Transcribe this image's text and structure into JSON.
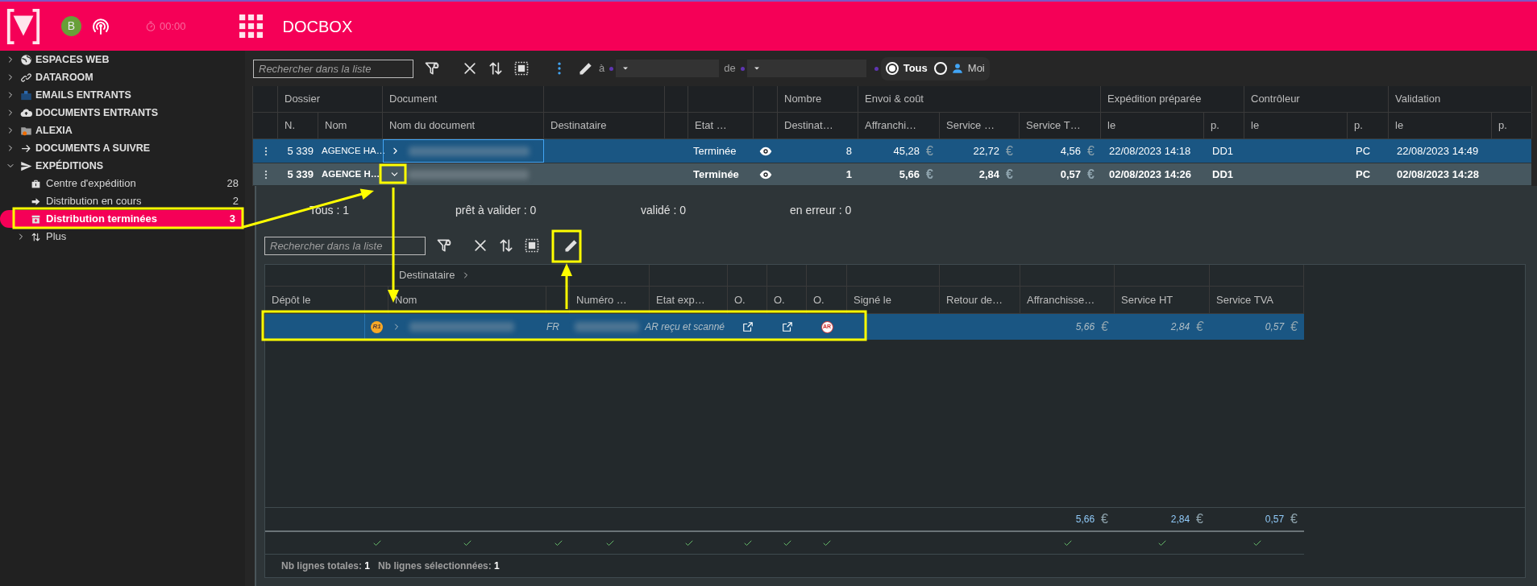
{
  "app": {
    "avatar": "B",
    "timer": "00:00",
    "title": "DOCBOX"
  },
  "sidebar": {
    "items": [
      {
        "label": "ESPACES WEB",
        "expanded": false
      },
      {
        "label": "DATAROOM",
        "expanded": false
      },
      {
        "label": "EMAILS ENTRANTS",
        "expanded": false
      },
      {
        "label": "DOCUMENTS ENTRANTS",
        "expanded": false
      },
      {
        "label": "ALEXIA",
        "expanded": false
      },
      {
        "label": "DOCUMENTS A SUIVRE",
        "expanded": false
      },
      {
        "label": "EXPÉDITIONS",
        "expanded": true,
        "children": [
          {
            "kind": "link",
            "label": "Centre d'expédition",
            "count": "28",
            "selected": false
          },
          {
            "kind": "link",
            "label": "Distribution en cours",
            "count": "2",
            "selected": false
          },
          {
            "kind": "link",
            "label": "Distribution terminées",
            "count": "3",
            "selected": true
          },
          {
            "kind": "group",
            "label": "Plus",
            "expanded": false,
            "selected": false
          }
        ]
      }
    ]
  },
  "toolbar": {
    "search_placeholder": "Rechercher dans la liste",
    "to_label": "à",
    "from_label": "de",
    "owner_filter": [
      {
        "label": "Tous",
        "selected": true
      },
      {
        "label": "Moi",
        "selected": false
      }
    ]
  },
  "table": {
    "groups": [
      {
        "columns": [
          {}
        ]
      },
      {
        "label": "Dossier",
        "columns": [
          {
            "label": "N."
          },
          {
            "label": "Nom"
          }
        ]
      },
      {
        "label": "Document",
        "columns": [
          {
            "label": "Nom du document"
          }
        ]
      },
      {
        "columns": [
          {
            "label": "Destinataire"
          }
        ]
      },
      {
        "columns": [
          {}
        ]
      },
      {
        "columns": [
          {
            "label": "Etat …"
          }
        ]
      },
      {
        "columns": [
          {}
        ]
      },
      {
        "label": "Nombre",
        "columns": [
          {
            "label": "Destinat…"
          }
        ]
      },
      {
        "label": "Envoi & coût",
        "columns": [
          {
            "label": "Affranchi…"
          },
          {
            "label": "Service …"
          },
          {
            "label": "Service T…"
          }
        ]
      },
      {
        "label": "Expédition préparée",
        "columns": [
          {
            "label": "le"
          },
          {
            "label": "p."
          }
        ]
      },
      {
        "label": "Contrôleur",
        "columns": [
          {
            "label": "le"
          },
          {
            "label": "p."
          }
        ]
      },
      {
        "label": "Validation",
        "columns": [
          {
            "label": "le"
          },
          {
            "label": "p."
          }
        ]
      }
    ],
    "rows": [
      {
        "selected": true,
        "expanded": false,
        "focused": true,
        "number": "5 339",
        "name": "AGENCE HA…",
        "status": "Terminée",
        "recipients": "8",
        "postage": {
          "value": "45,28",
          "currency": "€"
        },
        "service": {
          "value": "22,72",
          "currency": "€"
        },
        "service_tax": {
          "value": "4,56",
          "currency": "€"
        },
        "prepared_on": "22/08/2023 14:18",
        "prepared_by": "DD1",
        "controller_by": "PC",
        "validated_on": "22/08/2023 14:49"
      },
      {
        "selected": false,
        "expanded": true,
        "focused": false,
        "number": "5 339",
        "name": "AGENCE H…",
        "status": "Terminée",
        "recipients": "1",
        "postage": {
          "value": "5,66",
          "currency": "€"
        },
        "service": {
          "value": "2,84",
          "currency": "€"
        },
        "service_tax": {
          "value": "0,57",
          "currency": "€"
        },
        "prepared_on": "02/08/2023 14:26",
        "prepared_by": "DD1",
        "controller_by": "PC",
        "validated_on": "02/08/2023 14:28"
      }
    ]
  },
  "detail": {
    "counters": [
      "Tous : 1",
      "prêt à valider : 0",
      "validé : 0",
      "en erreur : 0"
    ],
    "search_placeholder": "Rechercher dans la liste",
    "groups": [
      {
        "columns": [
          {
            "label": "Dépôt le"
          }
        ]
      },
      {
        "label": "Destinataire",
        "columns": [
          {},
          {
            "label": "Nom"
          },
          {}
        ]
      },
      {
        "columns": [
          {
            "label": "Numéro …"
          }
        ]
      },
      {
        "columns": [
          {
            "label": "Etat exp…"
          }
        ]
      },
      {
        "columns": [
          {
            "label": "O."
          }
        ]
      },
      {
        "columns": [
          {
            "label": "O."
          }
        ]
      },
      {
        "columns": [
          {
            "label": "O."
          }
        ]
      },
      {
        "columns": [
          {
            "label": "Signé le"
          }
        ]
      },
      {
        "columns": [
          {
            "label": "Retour de…"
          }
        ]
      },
      {
        "columns": [
          {
            "label": "Affranchisse…"
          }
        ]
      },
      {
        "columns": [
          {
            "label": "Service HT"
          }
        ]
      },
      {
        "columns": [
          {
            "label": "Service TVA"
          }
        ]
      }
    ],
    "rows": [
      {
        "selected": true,
        "badge": "R1",
        "country": "FR",
        "status": "AR reçu et scanné",
        "receipt": "AR",
        "postage": {
          "value": "5,66",
          "currency": "€"
        },
        "service": {
          "value": "2,84",
          "currency": "€"
        },
        "service_tax": {
          "value": "0,57",
          "currency": "€"
        }
      }
    ],
    "totals": [
      {
        "value": "5,66",
        "currency": "€"
      },
      {
        "value": "2,84",
        "currency": "€"
      },
      {
        "value": "0,57",
        "currency": "€"
      }
    ],
    "column_checks": [
      {
        "checked": false
      },
      {
        "checked": true
      },
      {
        "checked": true
      },
      {
        "checked": true
      },
      {
        "checked": true
      },
      {
        "checked": true
      },
      {
        "checked": true
      },
      {
        "checked": true
      },
      {
        "checked": true
      },
      {
        "checked": false
      },
      {
        "checked": false
      },
      {
        "checked": true
      },
      {
        "checked": true
      },
      {
        "checked": true
      }
    ],
    "footer": [
      {
        "label": "Nb lignes totales:",
        "value": "1"
      },
      {
        "label": "Nb lignes sélectionnées:",
        "value": "1"
      }
    ]
  }
}
